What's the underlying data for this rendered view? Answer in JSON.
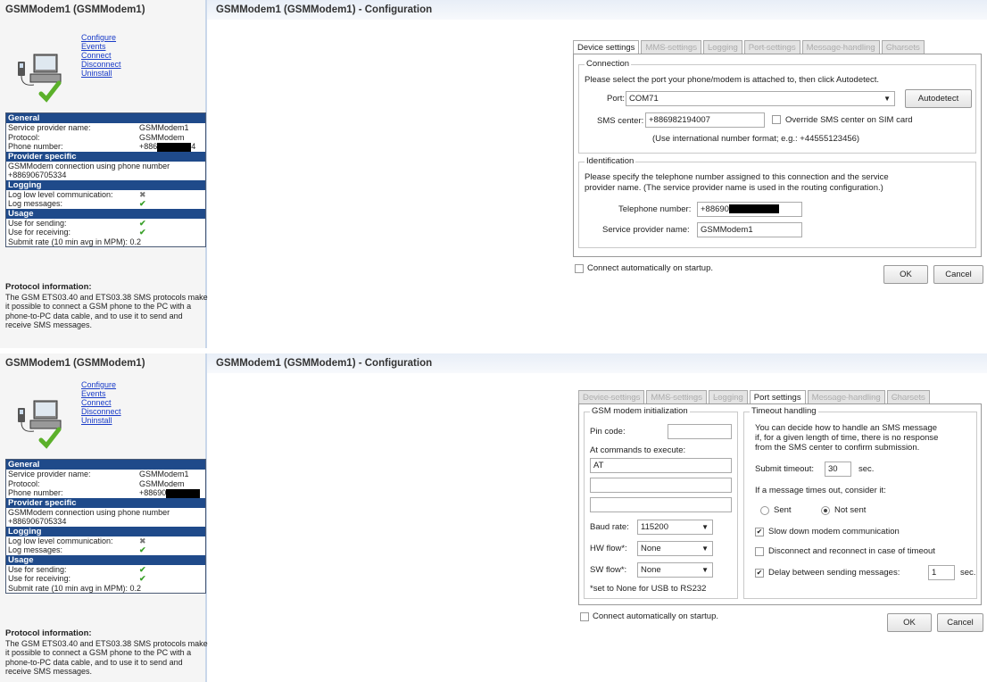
{
  "left": {
    "title": "GSMModem1 (GSMModem1)",
    "links": [
      "Configure",
      "Events",
      "Connect",
      "Disconnect",
      "Uninstall"
    ],
    "general_header": "General",
    "general_rows": [
      {
        "label": "Service provider name:",
        "value": "GSMModem1"
      },
      {
        "label": "Protocol:",
        "value": "GSMModem"
      }
    ],
    "phone_label": "Phone number:",
    "phone_prefix_top": "+886",
    "phone_suffix_top": "4",
    "phone_prefix_bottom": "+88690",
    "provider_header": "Provider specific",
    "provider_text": "GSMModem connection using phone number +886906705334",
    "logging_header": "Logging",
    "logging_rows": [
      {
        "label": "Log low level communication:",
        "value": "✖"
      },
      {
        "label": "Log messages:",
        "value": "✔"
      }
    ],
    "usage_header": "Usage",
    "usage_rows": [
      {
        "label": "Use for sending:",
        "value": "✔"
      },
      {
        "label": "Use for receiving:",
        "value": "✔"
      }
    ],
    "submit_rate": "Submit rate (10 min avg in MPM): 0.2",
    "protocol_title": "Protocol information:",
    "protocol_text": "The GSM ETS03.40 and ETS03.38 SMS protocols make it possible to connect a GSM phone to the PC with a phone-to-PC data cable, and to use it to send and receive SMS messages."
  },
  "right_title": "GSMModem1 (GSMModem1) - Configuration",
  "tabs": [
    "Device settings",
    "MMS settings",
    "Logging",
    "Port settings",
    "Message handling",
    "Charsets"
  ],
  "device": {
    "connection_legend": "Connection",
    "connection_intro": "Please select the port your phone/modem is attached to, then click Autodetect.",
    "port_label": "Port:",
    "port_value": "COM71",
    "autodetect": "Autodetect",
    "sms_center_label": "SMS center:",
    "sms_center_value": "+886982194007",
    "override_label": "Override SMS center on SIM card",
    "intl_hint": "(Use international number format; e.g.: +44555123456)",
    "identification_legend": "Identification",
    "identification_intro_1": "Please specify the telephone number assigned to this connection and the service",
    "identification_intro_2": "provider name. (The service provider name is used in the routing configuration.)",
    "telephone_label": "Telephone number:",
    "telephone_prefix": "+88690",
    "provider_label": "Service provider name:",
    "provider_value": "GSMModem1"
  },
  "port": {
    "gsm_legend": "GSM modem initialization",
    "pin_label": "Pin code:",
    "at_label": "At commands to execute:",
    "at_values": [
      "AT",
      "",
      ""
    ],
    "baud_label": "Baud rate:",
    "baud_value": "115200",
    "hw_label": "HW flow*:",
    "hw_value": "None",
    "sw_label": "SW flow*:",
    "sw_value": "None",
    "footnote": "*set to None for USB to RS232",
    "timeout_legend": "Timeout handling",
    "timeout_intro_1": "You can decide how to handle an SMS message",
    "timeout_intro_2": "if, for a given length of time, there is no response",
    "timeout_intro_3": "from the SMS center to confirm submission.",
    "submit_timeout_label": "Submit timeout:",
    "submit_timeout_value": "30",
    "sec": "sec.",
    "consider_label": "If a message times out, consider it:",
    "sent_label": "Sent",
    "not_sent_label": "Not sent",
    "slow_label": "Slow down modem communication",
    "disconnect_label": "Disconnect and reconnect in case of timeout",
    "delay_label": "Delay between sending messages:",
    "delay_value": "1"
  },
  "connect_auto": "Connect automatically on startup.",
  "ok": "OK",
  "cancel": "Cancel"
}
